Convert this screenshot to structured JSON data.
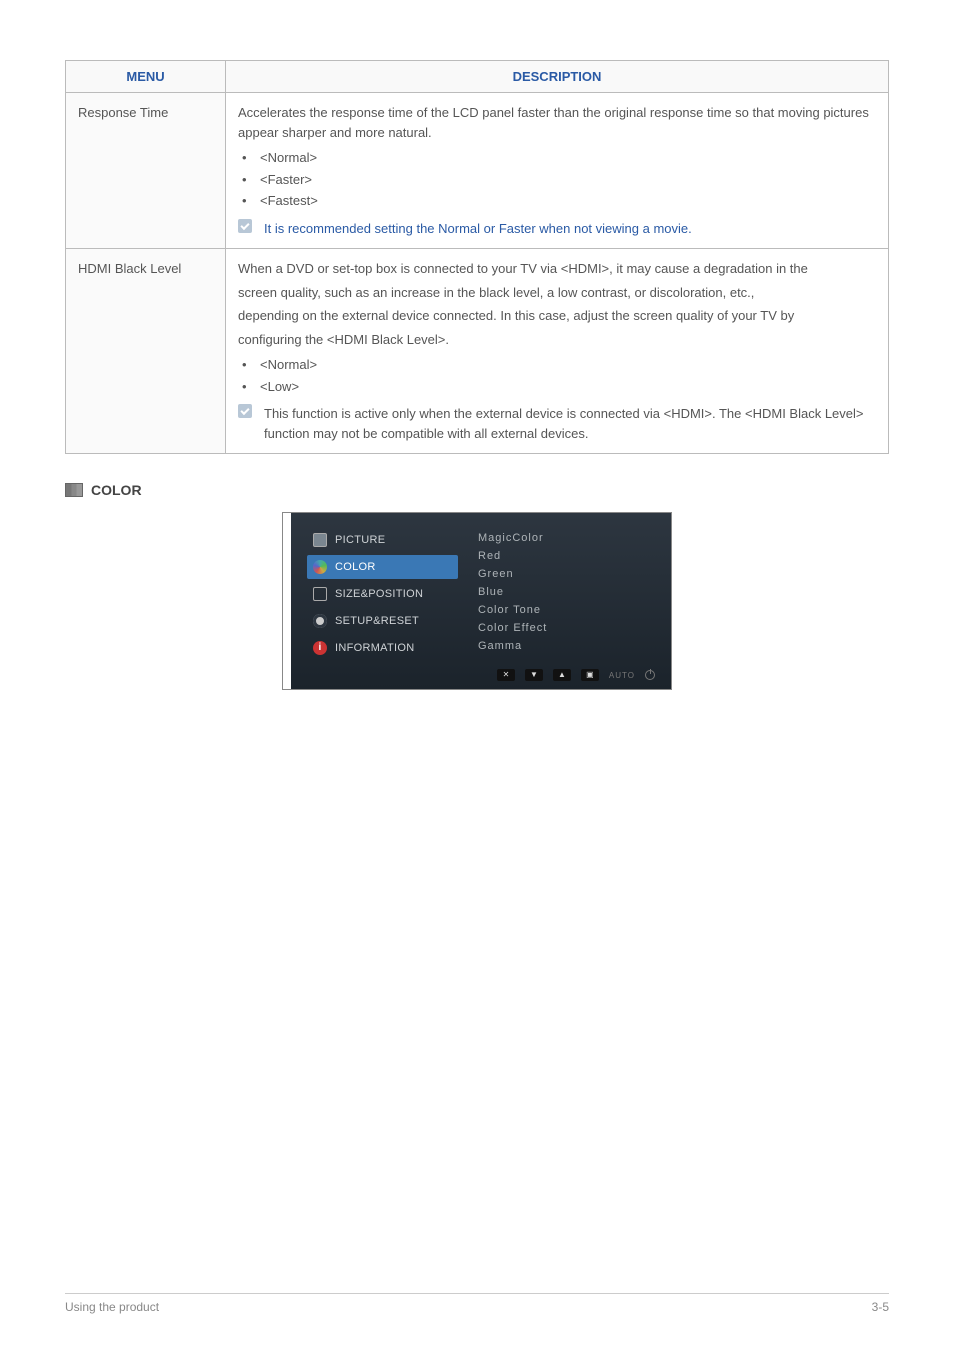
{
  "table": {
    "header": {
      "menu": "MENU",
      "description": "DESCRIPTION"
    },
    "rows": [
      {
        "menu": "Response Time",
        "description": "Accelerates the response time of the LCD panel faster than the original response time so that moving pictures appear sharper and more natural.",
        "options": [
          "<Normal>",
          "<Faster>",
          "<Fastest>"
        ],
        "note": "It is recommended setting the Normal or Faster when not viewing a movie."
      },
      {
        "menu": "HDMI Black Level",
        "description_lines": [
          "When a DVD or set-top box is connected to your TV via <HDMI>, it may cause a degradation in the",
          "screen quality, such as an increase in the black level, a low contrast, or discoloration, etc.,",
          "depending on the external device connected. In this case, adjust the screen quality of your TV by",
          "configuring the <HDMI Black Level>."
        ],
        "options": [
          "<Normal>",
          "<Low>"
        ],
        "note": "This function is active only when the external device is connected via <HDMI>. The <HDMI Black Level> function may not be compatible with all external devices."
      }
    ]
  },
  "section": {
    "title": "COLOR"
  },
  "osd": {
    "nav": [
      {
        "label": "PICTURE",
        "icon": "pic"
      },
      {
        "label": "COLOR",
        "icon": "col",
        "active": true
      },
      {
        "label": "SIZE&POSITION",
        "icon": "siz"
      },
      {
        "label": "SETUP&RESET",
        "icon": "set"
      },
      {
        "label": "INFORMATION",
        "icon": "inf"
      }
    ],
    "items": [
      "MagicColor",
      "Red",
      "Green",
      "Blue",
      "Color Tone",
      "Color Effect",
      "Gamma"
    ],
    "footer_auto": "AUTO"
  },
  "footer": {
    "left": "Using the product",
    "right": "3-5"
  }
}
